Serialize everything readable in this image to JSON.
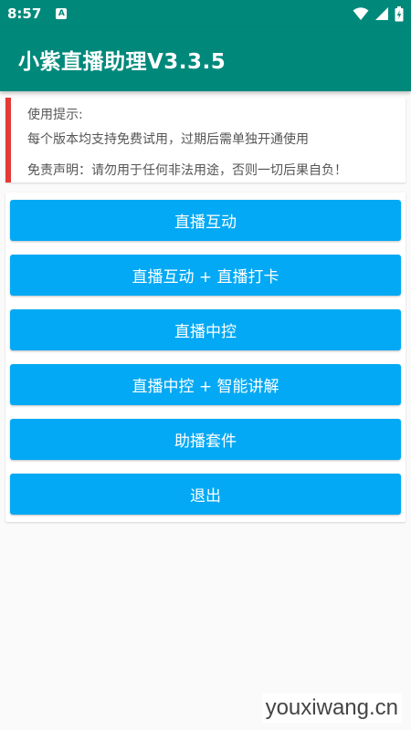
{
  "status_bar": {
    "time": "8:57",
    "notification_icon": "A"
  },
  "app_bar": {
    "title": "小紫直播助理V3.3.5"
  },
  "tips": {
    "title": "使用提示:",
    "line1": "每个版本均支持免费试用，过期后需单独开通使用",
    "line2": "免责声明：请勿用于任何非法用途，否则一切后果自负！"
  },
  "buttons": [
    {
      "label": "直播互动"
    },
    {
      "label": "直播互动 + 直播打卡"
    },
    {
      "label": "直播中控"
    },
    {
      "label": "直播中控 + 智能讲解"
    },
    {
      "label": "助播套件"
    },
    {
      "label": "退出"
    }
  ],
  "watermark": "youxiwang.cn",
  "colors": {
    "primary": "#00897b",
    "button": "#03a9f4",
    "tips_accent": "#e53935"
  }
}
